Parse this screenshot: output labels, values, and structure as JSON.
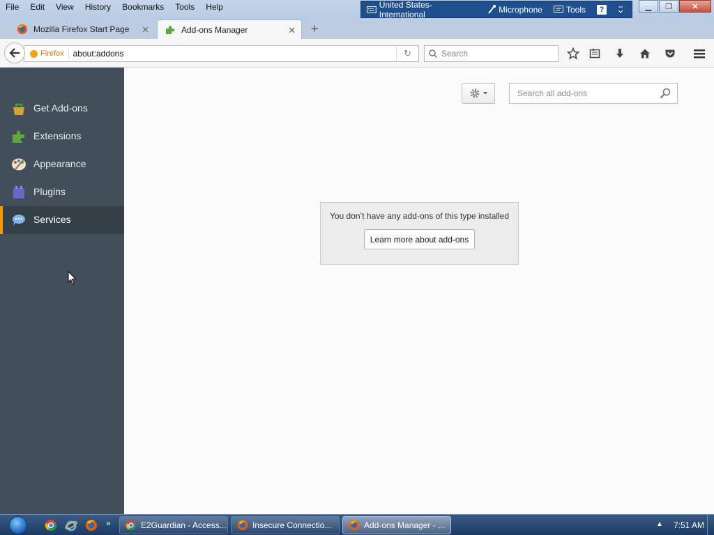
{
  "menubar": {
    "items": [
      {
        "label": "File"
      },
      {
        "label": "Edit"
      },
      {
        "label": "View"
      },
      {
        "label": "History"
      },
      {
        "label": "Bookmarks"
      },
      {
        "label": "Tools"
      },
      {
        "label": "Help"
      }
    ]
  },
  "langbar": {
    "language": "United States-International",
    "microphone": "Microphone",
    "tools": "Tools",
    "help": "?"
  },
  "tabs": [
    {
      "label": "Mozilla Firefox Start Page"
    },
    {
      "label": "Add-ons Manager"
    }
  ],
  "navbar": {
    "identity": "Firefox",
    "url": "about:addons",
    "search_placeholder": "Search"
  },
  "sidebar": {
    "items": [
      {
        "label": "Get Add-ons",
        "selected": false
      },
      {
        "label": "Extensions",
        "selected": false
      },
      {
        "label": "Appearance",
        "selected": false
      },
      {
        "label": "Plugins",
        "selected": false
      },
      {
        "label": "Services",
        "selected": true
      }
    ]
  },
  "content": {
    "search_placeholder": "Search all add-ons",
    "empty_message": "You don’t have any add-ons of this type installed",
    "learn_more_label": "Learn more about add-ons"
  },
  "taskbar": {
    "tasks": [
      {
        "label": "E2Guardian - Access...",
        "active": false
      },
      {
        "label": "Insecure Connectio...",
        "active": false
      },
      {
        "label": "Add-ons Manager - ...",
        "active": true
      }
    ],
    "more": "»",
    "clock": "7:51 AM"
  },
  "colors": {
    "sidebar_bg": "#424f5a",
    "selected_accent": "#ff9500",
    "content_bg": "#fbfbfb"
  }
}
